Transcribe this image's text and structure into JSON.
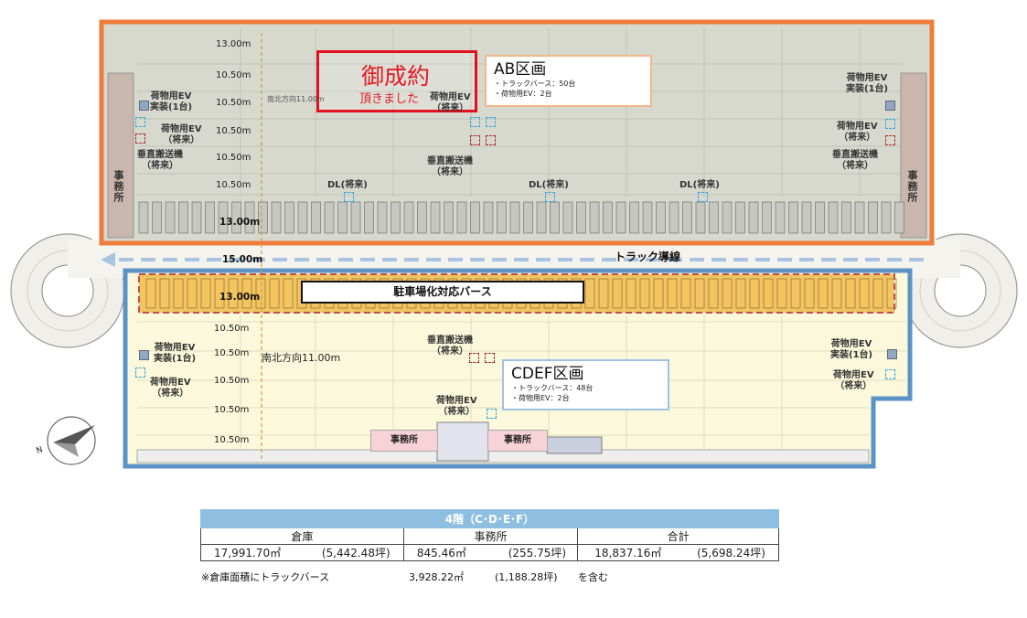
{
  "upper_floor": {
    "zone_title": "AB区画",
    "zone_line1": "・トラックバース：50台",
    "zone_line2": "・荷物用EV：2台",
    "contract_big": "御成約",
    "contract_small": "頂きました",
    "dims": [
      "13.00m",
      "10.50m",
      "10.50m",
      "10.50m",
      "10.50m",
      "10.50m",
      "13.00m"
    ],
    "north_south_label": "南北方向11.00m",
    "labels": {
      "ev_installed_left": "荷物用EV\n実装(1台)",
      "ev_future_left": "荷物用EV\n（将来）",
      "vertical_conveyor_left": "垂直搬送機\n（将来）",
      "ev_future_center": "荷物用EV\n（将来）",
      "vertical_conveyor_center": "垂直搬送機\n（将来）",
      "dl1": "DL(将来)",
      "dl2": "DL(将来)",
      "dl3": "DL(将来)",
      "ev_installed_right": "荷物用EV\n実装(1台)",
      "ev_future_right": "荷物用EV\n（将来）",
      "vertical_conveyor_right": "垂直搬送機\n（将来）",
      "office_left": "事務所",
      "office_right": "事務所"
    }
  },
  "truck_route": "トラック導線",
  "route_dim": "15.00m",
  "lower_floor": {
    "parking_banner": "駐車場化対応バース",
    "parking_dim": "13.00m",
    "zone_title": "CDEF区画",
    "zone_line1": "・トラックバース：48台",
    "zone_line2": "・荷物用EV：2台",
    "dims": [
      "10.50m",
      "10.50m",
      "10.50m",
      "10.50m",
      "10.50m"
    ],
    "north_south_label": "南北方向11.00m",
    "labels": {
      "ev_installed_left": "荷物用EV\n実装(1台)",
      "ev_future_left": "荷物用EV\n（将来）",
      "vertical_conveyor_center": "垂直搬送機\n（将来）",
      "ev_future_center": "荷物用EV\n（将来）",
      "ev_installed_right": "荷物用EV\n実装(1台)",
      "ev_future_right": "荷物用EV\n（将来）",
      "office_1": "事務所",
      "office_2": "事務所"
    }
  },
  "compass_label": "N",
  "summary_table": {
    "title": "4階（C･D･E･F）",
    "headers": [
      "倉庫",
      "事務所",
      "合計"
    ],
    "warehouse_m2": "17,991.70㎡",
    "warehouse_tsubo": "(5,442.48坪)",
    "office_m2": "845.46㎡",
    "office_tsubo": "(255.75坪)",
    "total_m2": "18,837.16㎡",
    "total_tsubo": "(5,698.24坪)",
    "note_prefix": "※倉庫面積にトラックバース",
    "note_m2": "3,928.22㎡",
    "note_tsubo": "(1,188.28坪)",
    "note_suffix": "を含む"
  },
  "colors": {
    "upper_border": "#ee7d3b",
    "upper_fill": "#d7d9cf",
    "lower_border": "#5b93c7",
    "lower_fill": "#fbf8dc",
    "parking_fill": "#f3c462",
    "route_arrow": "#a9c4e3",
    "contract_red": "#e0101c",
    "table_header": "#8fbfe0"
  }
}
